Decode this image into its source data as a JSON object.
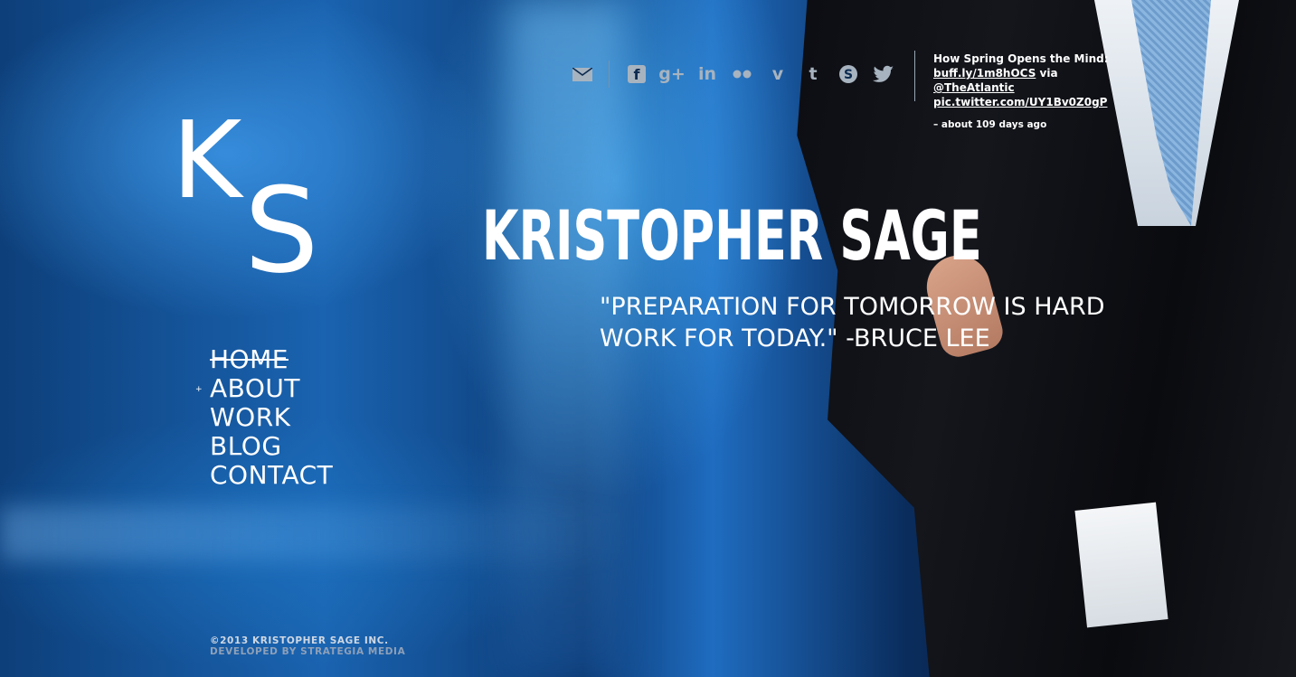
{
  "logo": {
    "k": "K",
    "s": "S"
  },
  "nav": {
    "items": [
      {
        "label": "HOME"
      },
      {
        "label": "ABOUT"
      },
      {
        "label": "WORK"
      },
      {
        "label": "BLOG"
      },
      {
        "label": "CONTACT"
      }
    ],
    "marker": "+"
  },
  "social": {
    "icons": [
      "email-icon",
      "facebook-icon",
      "google-plus-icon",
      "linkedin-icon",
      "flickr-icon",
      "vimeo-icon",
      "tumblr-icon",
      "skype-icon",
      "twitter-icon"
    ]
  },
  "tweet": {
    "text": "How Spring Opens the Mind:",
    "link1": "buff.ly/1m8hOCS",
    "via": "via",
    "handle": "@TheAtlantic",
    "link2": "pic.twitter.com/UY1Bv0Z0gP",
    "time": "– about 109 days ago"
  },
  "hero": {
    "name": "KRISTOPHER SAGE",
    "quote_line1": "\"PREPARATION FOR TOMORROW IS HARD",
    "quote_line2": "WORK FOR TODAY.\" -BRUCE LEE"
  },
  "footer": {
    "copyright": "©2013 KRISTOPHER SAGE INC.",
    "developer": "DEVELOPED BY STRATEGIA MEDIA"
  }
}
